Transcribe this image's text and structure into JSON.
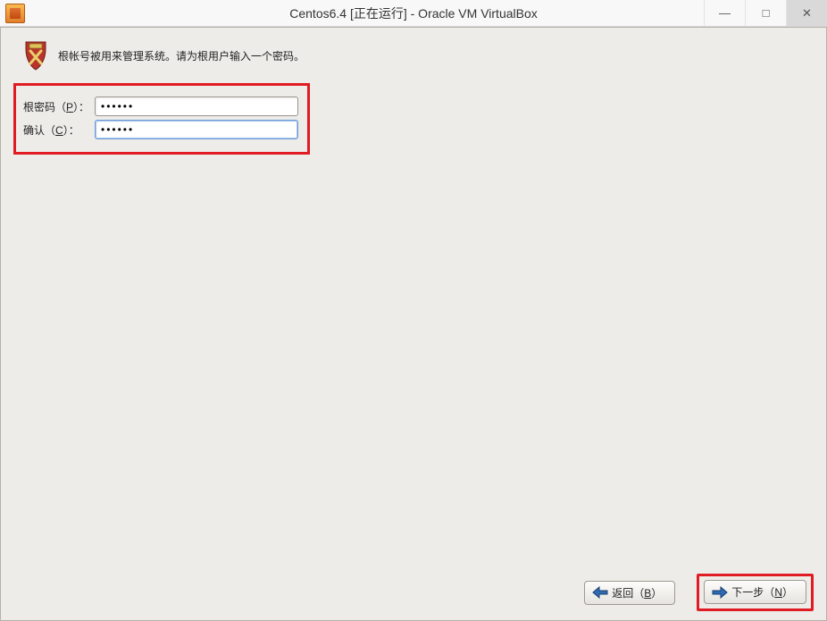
{
  "window": {
    "title": "Centos6.4 [正在运行] - Oracle VM VirtualBox",
    "minimize_glyph": "—",
    "maximize_glyph": "□",
    "close_glyph": "✕"
  },
  "info": {
    "message": "根帐号被用来管理系统。请为根用户输入一个密码。"
  },
  "form": {
    "password_label_pre": "根密码（",
    "password_label_key": "P",
    "password_label_post": "）：",
    "password_value": "••••••",
    "confirm_label_pre": "确认（",
    "confirm_label_key": "C",
    "confirm_label_post": "）：",
    "confirm_value": "••••••"
  },
  "buttons": {
    "back_icon": "back-arrow",
    "back_label_pre": "返回（",
    "back_label_key": "B",
    "back_label_post": "）",
    "next_icon": "forward-arrow",
    "next_label_pre": "下一步（",
    "next_label_key": "N",
    "next_label_post": "）"
  },
  "colors": {
    "highlight": "#e01b24",
    "bg": "#edece9"
  }
}
